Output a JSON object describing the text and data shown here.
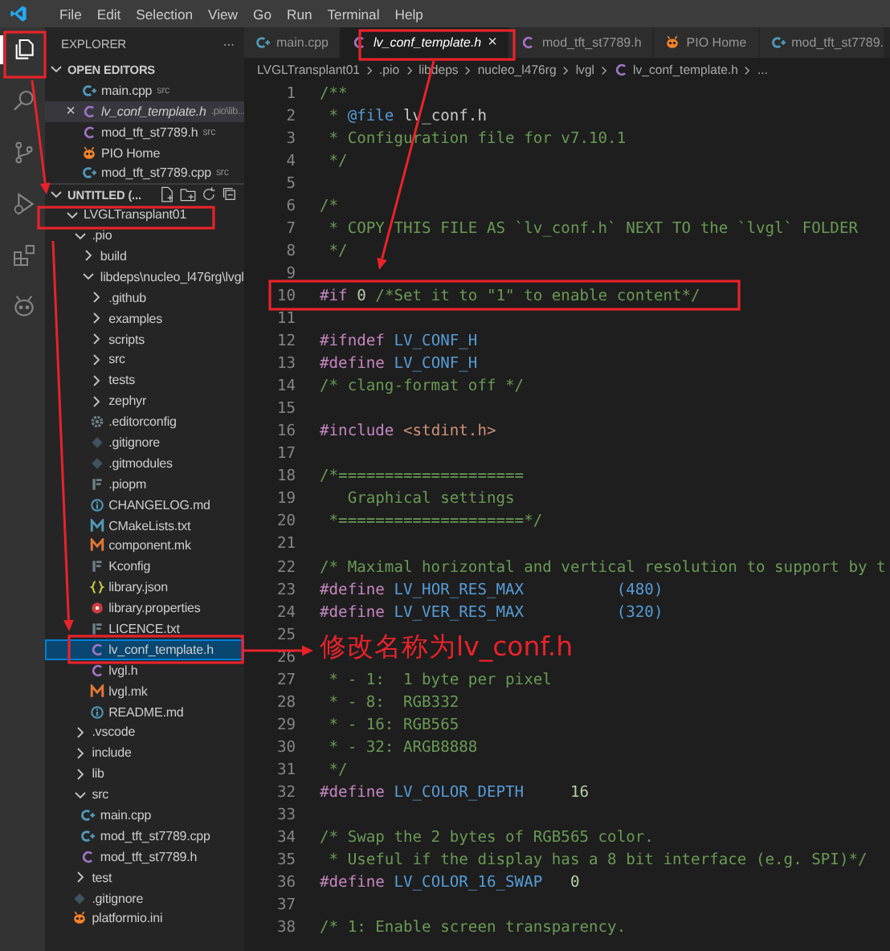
{
  "menu": [
    "File",
    "Edit",
    "Selection",
    "View",
    "Go",
    "Run",
    "Terminal",
    "Help"
  ],
  "activity_bar": [
    {
      "kind": "files",
      "selected": true
    },
    {
      "kind": "search",
      "selected": false
    },
    {
      "kind": "branch",
      "selected": false
    },
    {
      "kind": "debug",
      "selected": false
    },
    {
      "kind": "extensions",
      "selected": false
    },
    {
      "kind": "pio",
      "selected": false
    }
  ],
  "sidebar": {
    "title": "EXPLORER",
    "more": "···",
    "open_editors": {
      "title": "OPEN EDITORS",
      "items": [
        {
          "name": "main.cpp",
          "hint": "src",
          "kind": "cpp",
          "selected": false,
          "preview": false
        },
        {
          "name": "lv_conf_template.h",
          "hint": ".pio\\lib...",
          "kind": "c",
          "selected": true,
          "preview": true,
          "close": "×"
        },
        {
          "name": "mod_tft_st7789.h",
          "hint": "src",
          "kind": "c",
          "selected": false,
          "preview": false
        },
        {
          "name": "PIO Home",
          "kind": "pio",
          "selected": false,
          "preview": false
        },
        {
          "name": "mod_tft_st7789.cpp",
          "hint": "src",
          "kind": "cpp",
          "selected": false,
          "preview": false
        }
      ]
    },
    "workspace": {
      "title": "UNTITLED (...",
      "tree": [
        {
          "name": "LVGLTransplant01",
          "kind": "folder",
          "expanded": true,
          "selected": false,
          "children": [
            {
              "name": ".pio",
              "kind": "folder",
              "expanded": true,
              "selected": false,
              "children": [
                {
                  "name": "build",
                  "kind": "folder",
                  "expanded": false,
                  "selected": false
                },
                {
                  "name": "libdeps\\nucleo_l476rg\\lvgl",
                  "kind": "folder",
                  "expanded": true,
                  "selected": false,
                  "children": [
                    {
                      "name": ".github",
                      "kind": "folder",
                      "expanded": false,
                      "selected": false
                    },
                    {
                      "name": "examples",
                      "kind": "folder",
                      "expanded": false,
                      "selected": false
                    },
                    {
                      "name": "scripts",
                      "kind": "folder",
                      "expanded": false,
                      "selected": false
                    },
                    {
                      "name": "src",
                      "kind": "folder",
                      "expanded": false,
                      "selected": false
                    },
                    {
                      "name": "tests",
                      "kind": "folder",
                      "expanded": false,
                      "selected": false
                    },
                    {
                      "name": "zephyr",
                      "kind": "folder",
                      "expanded": false,
                      "selected": false
                    },
                    {
                      "name": ".editorconfig",
                      "kind": "gear",
                      "selected": false
                    },
                    {
                      "name": ".gitignore",
                      "kind": "git",
                      "selected": false
                    },
                    {
                      "name": ".gitmodules",
                      "kind": "git",
                      "selected": false
                    },
                    {
                      "name": ".piopm",
                      "kind": "lines",
                      "selected": false
                    },
                    {
                      "name": "CHANGELOG.md",
                      "kind": "info",
                      "selected": false
                    },
                    {
                      "name": "CMakeLists.txt",
                      "kind": "cmake",
                      "selected": false
                    },
                    {
                      "name": "component.mk",
                      "kind": "make",
                      "selected": false
                    },
                    {
                      "name": "Kconfig",
                      "kind": "lines",
                      "selected": false
                    },
                    {
                      "name": "library.json",
                      "kind": "json",
                      "selected": false
                    },
                    {
                      "name": "library.properties",
                      "kind": "properties",
                      "selected": false
                    },
                    {
                      "name": "LICENCE.txt",
                      "kind": "lines",
                      "selected": false
                    },
                    {
                      "name": "lv_conf_template.h",
                      "kind": "c",
                      "selected": true
                    },
                    {
                      "name": "lvgl.h",
                      "kind": "c",
                      "selected": false
                    },
                    {
                      "name": "lvgl.mk",
                      "kind": "make",
                      "selected": false
                    },
                    {
                      "name": "README.md",
                      "kind": "info",
                      "selected": false
                    }
                  ]
                }
              ]
            },
            {
              "name": ".vscode",
              "kind": "folder",
              "expanded": false,
              "selected": false
            },
            {
              "name": "include",
              "kind": "folder",
              "expanded": false,
              "selected": false
            },
            {
              "name": "lib",
              "kind": "folder",
              "expanded": false,
              "selected": false
            },
            {
              "name": "src",
              "kind": "folder",
              "expanded": true,
              "selected": false,
              "children": [
                {
                  "name": "main.cpp",
                  "kind": "cpp",
                  "selected": false
                },
                {
                  "name": "mod_tft_st7789.cpp",
                  "kind": "cpp",
                  "selected": false
                },
                {
                  "name": "mod_tft_st7789.h",
                  "kind": "c",
                  "selected": false
                }
              ]
            },
            {
              "name": "test",
              "kind": "folder",
              "expanded": false,
              "selected": false
            },
            {
              "name": ".gitignore",
              "kind": "git",
              "selected": false
            },
            {
              "name": "platformio.ini",
              "kind": "pio",
              "selected": false
            }
          ]
        }
      ]
    }
  },
  "tabs": [
    {
      "label": "main.cpp",
      "kind": "cpp",
      "selected": false,
      "preview": false
    },
    {
      "label": "lv_conf_template.h",
      "kind": "c",
      "selected": true,
      "preview": true,
      "close": "×"
    },
    {
      "label": "mod_tft_st7789.h",
      "kind": "c",
      "selected": false,
      "preview": false
    },
    {
      "label": "PIO Home",
      "kind": "pio",
      "selected": false,
      "preview": false
    },
    {
      "label": "mod_tft_st7789.",
      "kind": "cpp",
      "selected": false,
      "preview": false
    }
  ],
  "breadcrumb": [
    {
      "label": "LVGLTransplant01"
    },
    {
      "label": ".pio"
    },
    {
      "label": "libdeps"
    },
    {
      "label": "nucleo_l476rg"
    },
    {
      "label": "lvgl"
    },
    {
      "label": "lv_conf_template.h",
      "kind": "c"
    },
    {
      "label": "..."
    }
  ],
  "code": [
    {
      "number": "1",
      "tokens": [
        {
          "kind": "comment",
          "text": "/**"
        }
      ]
    },
    {
      "number": "2",
      "tokens": [
        {
          "kind": "comment",
          "text": " * "
        },
        {
          "kind": "doctag",
          "text": "@file"
        },
        {
          "kind": "doctext",
          "text": " lv_conf.h"
        }
      ]
    },
    {
      "number": "3",
      "tokens": [
        {
          "kind": "comment",
          "text": " * Configuration file for v7.10.1"
        }
      ]
    },
    {
      "number": "4",
      "tokens": [
        {
          "kind": "comment",
          "text": " */"
        }
      ]
    },
    {
      "number": "5"
    },
    {
      "number": "6",
      "tokens": [
        {
          "kind": "comment",
          "text": "/*"
        }
      ]
    },
    {
      "number": "7",
      "tokens": [
        {
          "kind": "comment",
          "text": " * COPY THIS FILE AS `lv_conf.h` NEXT TO the `lvgl` FOLDER"
        }
      ]
    },
    {
      "number": "8",
      "tokens": [
        {
          "kind": "comment",
          "text": " */"
        }
      ]
    },
    {
      "number": "9"
    },
    {
      "number": "10",
      "tokens": [
        {
          "kind": "preproc",
          "text": "#if"
        },
        {
          "kind": "number",
          "text": " 0"
        },
        {
          "kind": "comment",
          "text": " /*Set it to \"1\" to enable content*/"
        }
      ]
    },
    {
      "number": "11"
    },
    {
      "number": "12",
      "tokens": [
        {
          "kind": "preproc",
          "text": "#ifndef"
        },
        {
          "kind": "macro",
          "text": " LV_CONF_H"
        }
      ]
    },
    {
      "number": "13",
      "tokens": [
        {
          "kind": "preproc",
          "text": "#define"
        },
        {
          "kind": "macro",
          "text": " LV_CONF_H"
        }
      ]
    },
    {
      "number": "14",
      "tokens": [
        {
          "kind": "comment",
          "text": "/* clang-format off */"
        }
      ]
    },
    {
      "number": "15"
    },
    {
      "number": "16",
      "tokens": [
        {
          "kind": "preproc",
          "text": "#include"
        },
        {
          "kind": "string",
          "text": " <stdint.h>"
        }
      ]
    },
    {
      "number": "17"
    },
    {
      "number": "18",
      "tokens": [
        {
          "kind": "comment",
          "text": "/*===================="
        }
      ]
    },
    {
      "number": "19",
      "tokens": [
        {
          "kind": "comment",
          "text": "   Graphical settings"
        }
      ]
    },
    {
      "number": "20",
      "tokens": [
        {
          "kind": "comment",
          "text": " *====================*/"
        }
      ]
    },
    {
      "number": "21"
    },
    {
      "number": "22",
      "tokens": [
        {
          "kind": "comment",
          "text": "/* Maximal horizontal and vertical resolution to support by t"
        }
      ]
    },
    {
      "number": "23",
      "tokens": [
        {
          "kind": "preproc",
          "text": "#define"
        },
        {
          "kind": "macro",
          "text": " LV_HOR_RES_MAX          (480)"
        }
      ]
    },
    {
      "number": "24",
      "tokens": [
        {
          "kind": "preproc",
          "text": "#define"
        },
        {
          "kind": "macro",
          "text": " LV_VER_RES_MAX          (320)"
        }
      ]
    },
    {
      "number": "25"
    },
    {
      "number": "26"
    },
    {
      "number": "27",
      "tokens": [
        {
          "kind": "comment",
          "text": " * - 1:  1 byte per pixel"
        }
      ]
    },
    {
      "number": "28",
      "tokens": [
        {
          "kind": "comment",
          "text": " * - 8:  RGB332"
        }
      ]
    },
    {
      "number": "29",
      "tokens": [
        {
          "kind": "comment",
          "text": " * - 16: RGB565"
        }
      ]
    },
    {
      "number": "30",
      "tokens": [
        {
          "kind": "comment",
          "text": " * - 32: ARGB8888"
        }
      ]
    },
    {
      "number": "31",
      "tokens": [
        {
          "kind": "comment",
          "text": " */"
        }
      ]
    },
    {
      "number": "32",
      "tokens": [
        {
          "kind": "preproc",
          "text": "#define"
        },
        {
          "kind": "macro",
          "text": " LV_COLOR_DEPTH"
        },
        {
          "kind": "number",
          "text": "     16"
        }
      ]
    },
    {
      "number": "33"
    },
    {
      "number": "34",
      "tokens": [
        {
          "kind": "comment",
          "text": "/* Swap the 2 bytes of RGB565 color."
        }
      ]
    },
    {
      "number": "35",
      "tokens": [
        {
          "kind": "comment",
          "text": " * Useful if the display has a 8 bit interface (e.g. SPI)*/"
        }
      ]
    },
    {
      "number": "36",
      "tokens": [
        {
          "kind": "preproc",
          "text": "#define"
        },
        {
          "kind": "macro",
          "text": " LV_COLOR_16_SWAP"
        },
        {
          "kind": "number",
          "text": "   0"
        }
      ]
    },
    {
      "number": "37"
    },
    {
      "number": "38",
      "tokens": [
        {
          "kind": "comment",
          "text": "/* 1: Enable screen transparency."
        }
      ]
    }
  ],
  "annotations": {
    "label": "修改名称为lv_conf.h"
  }
}
